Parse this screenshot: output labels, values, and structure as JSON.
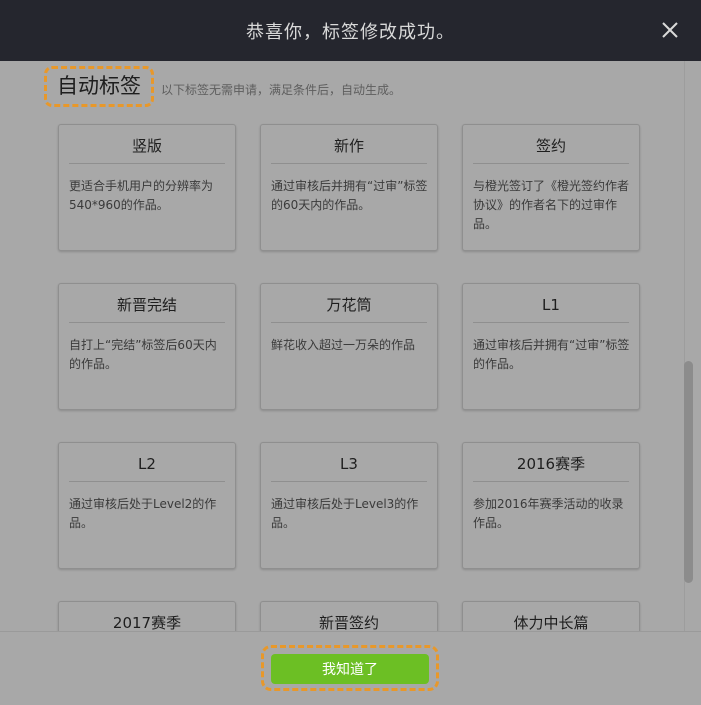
{
  "dialog": {
    "title": "恭喜你，标签修改成功。",
    "close_icon": "close-icon"
  },
  "section": {
    "title": "自动标签",
    "description": "以下标签无需申请，满足条件后，自动生成。"
  },
  "cards": [
    {
      "title": "竖版",
      "desc": "更适合手机用户的分辨率为540*960的作品。"
    },
    {
      "title": "新作",
      "desc": "通过审核后并拥有“过审”标签的60天内的作品。"
    },
    {
      "title": "签约",
      "desc": "与橙光签订了《橙光签约作者协议》的作者名下的过审作品。"
    },
    {
      "title": "新晋完结",
      "desc": "自打上“完结”标签后60天内的作品。"
    },
    {
      "title": "万花筒",
      "desc": "鲜花收入超过一万朵的作品"
    },
    {
      "title": "L1",
      "desc": "通过审核后并拥有“过审”标签的作品。"
    },
    {
      "title": "L2",
      "desc": "通过审核后处于Level2的作品。"
    },
    {
      "title": "L3",
      "desc": "通过审核后处于Level3的作品。"
    },
    {
      "title": "2016赛季",
      "desc": "参加2016年赛季活动的收录作品。"
    },
    {
      "title": "2017赛季",
      "desc": ""
    },
    {
      "title": "新晋签约",
      "desc": ""
    },
    {
      "title": "体力中长篇",
      "desc": ""
    }
  ],
  "footer": {
    "confirm_label": "我知道了"
  }
}
